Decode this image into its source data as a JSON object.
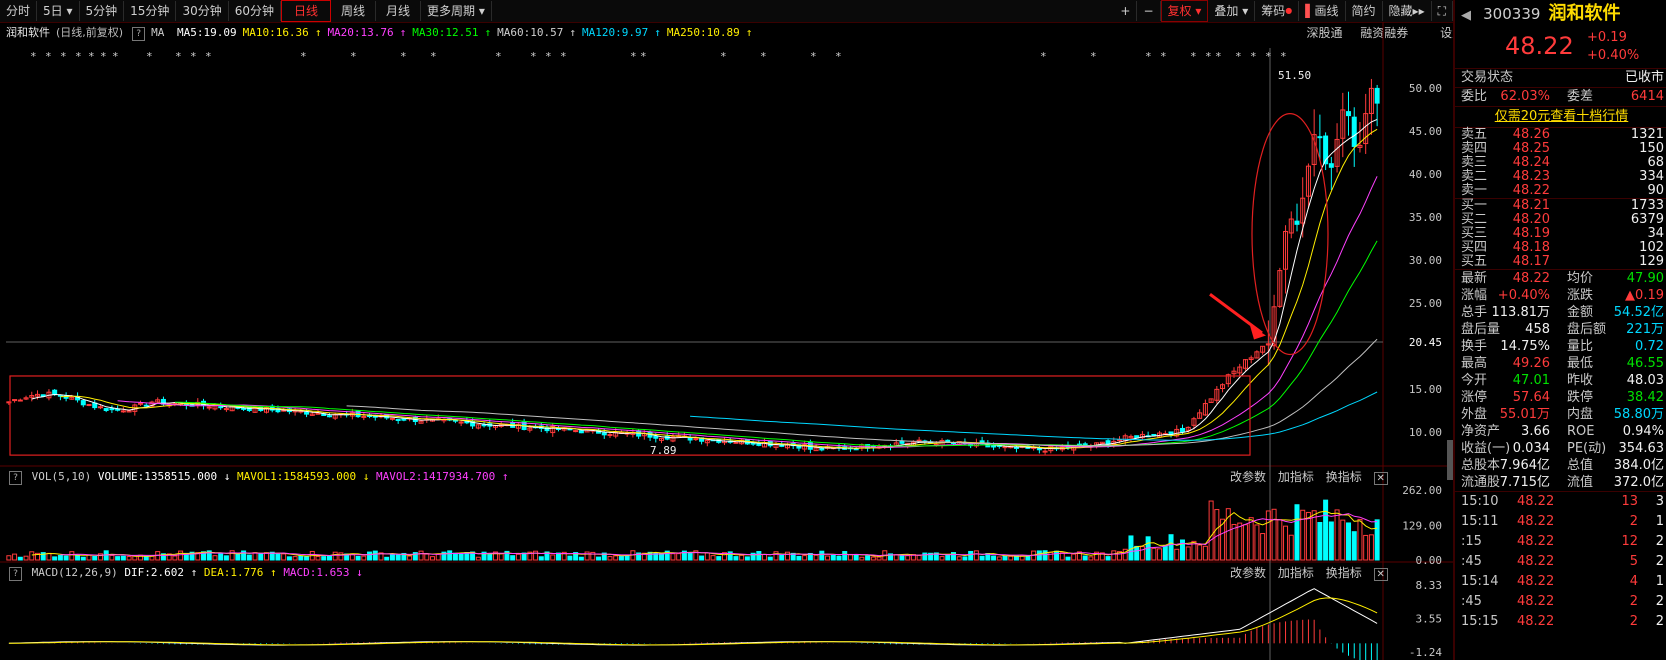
{
  "toolbar": {
    "periods": [
      "分时",
      "5日",
      "5分钟",
      "15分钟",
      "30分钟",
      "60分钟",
      "日线",
      "周线",
      "月线",
      "更多周期"
    ],
    "active_period": "日线",
    "right_buttons": [
      "+",
      "−",
      "复权",
      "叠加",
      "筹码",
      "画线",
      "简约",
      "隐藏"
    ]
  },
  "info": {
    "stock_name": "润和软件",
    "mode": "(日线,前复权)",
    "ma_label": "MA",
    "ma5": "MA5:19.09",
    "ma10": "MA10:16.36",
    "ma20": "MA20:13.76",
    "ma30": "MA30:12.51",
    "ma60": "MA60:10.57",
    "ma120": "MA120:9.97",
    "ma250": "MA250:10.89",
    "links": [
      "深股通",
      "融资融券",
      "设置均线"
    ]
  },
  "price_axis": [
    "50.00",
    "45.00",
    "40.00",
    "35.00",
    "30.00",
    "25.00",
    "20.45",
    "15.00",
    "10.00"
  ],
  "high_label": "51.50",
  "low_label": "7.89",
  "volume": {
    "title": "VOL(5,10)",
    "volume": "VOLUME:1358515.000",
    "mavol1": "MAVOL1:1584593.000",
    "mavol2": "MAVOL2:1417934.700",
    "axis": [
      "262.00",
      "129.00",
      "0.00"
    ],
    "links": [
      "改参数",
      "加指标",
      "换指标"
    ]
  },
  "macd": {
    "title": "MACD(12,26,9)",
    "dif": "DIF:2.602",
    "dea": "DEA:1.776",
    "macd": "MACD:1.653",
    "axis": [
      "8.33",
      "3.55",
      "-1.24"
    ],
    "links": [
      "改参数",
      "加指标",
      "换指标"
    ]
  },
  "colors": {
    "ma5": "#ffffff",
    "ma10": "#ffee00",
    "ma20": "#ff40ff",
    "ma30": "#00ff00",
    "ma60": "#c0c0c0",
    "ma120": "#00d8ff",
    "ma250": "#ffee00",
    "up": "#ff3b3b",
    "down": "#00ffff"
  },
  "quote": {
    "code": "300339",
    "name": "润和软件",
    "price": "48.22",
    "change": "+0.19",
    "change_pct": "+0.40%",
    "status_label": "交易状态",
    "status_value": "已收市",
    "ratio_label": "委比",
    "ratio_value": "62.03%",
    "diff_label": "委差",
    "diff_value": "6414",
    "promo": "仅需20元查看十档行情",
    "asks": [
      {
        "label": "卖五",
        "price": "48.26",
        "vol": "1321"
      },
      {
        "label": "卖四",
        "price": "48.25",
        "vol": "150"
      },
      {
        "label": "卖三",
        "price": "48.24",
        "vol": "68"
      },
      {
        "label": "卖二",
        "price": "48.23",
        "vol": "334"
      },
      {
        "label": "卖一",
        "price": "48.22",
        "vol": "90"
      }
    ],
    "bids": [
      {
        "label": "买一",
        "price": "48.21",
        "vol": "1733"
      },
      {
        "label": "买二",
        "price": "48.20",
        "vol": "6379"
      },
      {
        "label": "买三",
        "price": "48.19",
        "vol": "34"
      },
      {
        "label": "买四",
        "price": "48.18",
        "vol": "102"
      },
      {
        "label": "买五",
        "price": "48.17",
        "vol": "129"
      }
    ],
    "stats": [
      {
        "l1": "最新",
        "v1": "48.22",
        "c1": "red",
        "l2": "均价",
        "v2": "47.90",
        "c2": "green"
      },
      {
        "l1": "涨幅",
        "v1": "+0.40%",
        "c1": "red",
        "l2": "涨跌",
        "v2": "▲0.19",
        "c2": "red"
      },
      {
        "l1": "总手",
        "v1": "113.81万",
        "c1": "white",
        "l2": "金额",
        "v2": "54.52亿",
        "c2": "cyan"
      },
      {
        "l1": "盘后量",
        "v1": "458",
        "c1": "white",
        "l2": "盘后额",
        "v2": "221万",
        "c2": "cyan"
      },
      {
        "l1": "换手",
        "v1": "14.75%",
        "c1": "white",
        "l2": "量比",
        "v2": "0.72",
        "c2": "cyan"
      },
      {
        "l1": "最高",
        "v1": "49.26",
        "c1": "red",
        "l2": "最低",
        "v2": "46.55",
        "c2": "green"
      },
      {
        "l1": "今开",
        "v1": "47.01",
        "c1": "green",
        "l2": "昨收",
        "v2": "48.03",
        "c2": "white"
      },
      {
        "l1": "涨停",
        "v1": "57.64",
        "c1": "red",
        "l2": "跌停",
        "v2": "38.42",
        "c2": "green"
      },
      {
        "l1": "外盘",
        "v1": "55.01万",
        "c1": "red",
        "l2": "内盘",
        "v2": "58.80万",
        "c2": "cyan"
      },
      {
        "l1": "净资产",
        "v1": "3.66",
        "c1": "white",
        "l2": "ROE",
        "v2": "0.94%",
        "c2": "white"
      },
      {
        "l1": "收益(一)",
        "v1": "0.034",
        "c1": "white",
        "l2": "PE(动)",
        "v2": "354.63",
        "c2": "white"
      },
      {
        "l1": "总股本",
        "v1": "7.964亿",
        "c1": "white",
        "l2": "总值",
        "v2": "384.0亿",
        "c2": "white"
      },
      {
        "l1": "流通股",
        "v1": "7.715亿",
        "c1": "white",
        "l2": "流值",
        "v2": "372.0亿",
        "c2": "white"
      }
    ],
    "ticks": [
      {
        "time": "15:10",
        "price": "48.22",
        "vol": "13",
        "n": "3"
      },
      {
        "time": "15:11",
        "price": "48.22",
        "vol": "2",
        "n": "1"
      },
      {
        "time": ":15",
        "price": "48.22",
        "vol": "12",
        "n": "2"
      },
      {
        "time": ":45",
        "price": "48.22",
        "vol": "5",
        "n": "2"
      },
      {
        "time": "15:14",
        "price": "48.22",
        "vol": "4",
        "n": "1"
      },
      {
        "time": ":45",
        "price": "48.22",
        "vol": "2",
        "n": "2"
      },
      {
        "time": "15:15",
        "price": "48.22",
        "vol": "2",
        "n": "2"
      }
    ]
  }
}
